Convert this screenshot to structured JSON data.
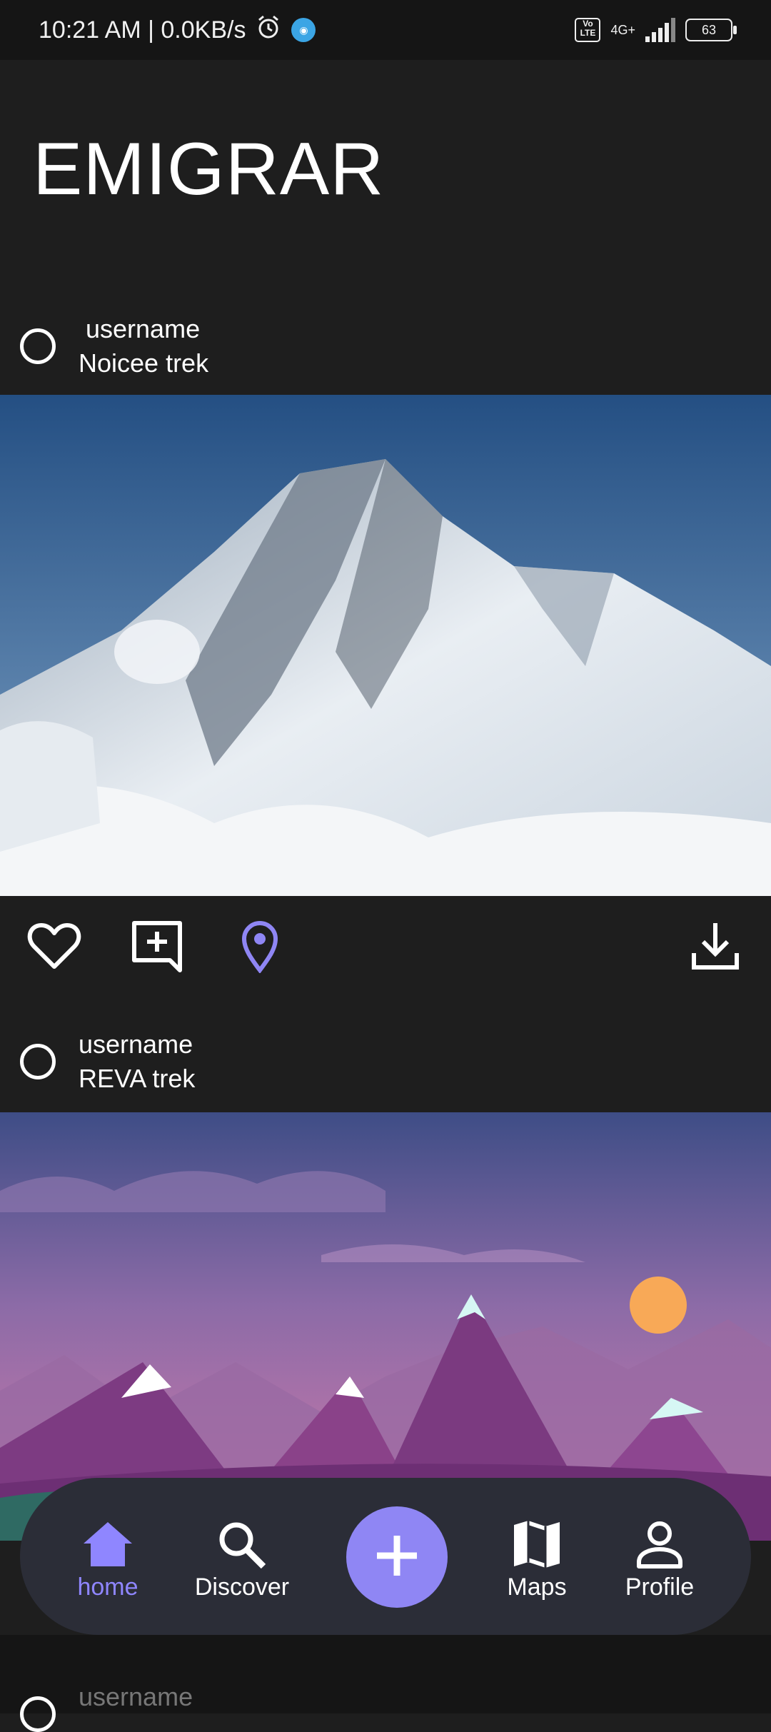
{
  "status_bar": {
    "time": "10:21 AM | 0.0KB/s",
    "volte": "Vo LTE",
    "network": "4G+",
    "battery": "63"
  },
  "app": {
    "title": "EMIGRAR"
  },
  "posts": [
    {
      "username": "username",
      "trek": "Noicee trek"
    },
    {
      "username": "username",
      "trek": "REVA trek"
    },
    {
      "username": "username"
    }
  ],
  "nav": {
    "home": "home",
    "discover": "Discover",
    "maps": "Maps",
    "profile": "Profile"
  },
  "colors": {
    "accent": "#8f86f4",
    "background": "#1e1e1e",
    "nav": "#2b2d37"
  },
  "icons": [
    "alarm-icon",
    "app-badge-icon",
    "heart-icon",
    "add-comment-icon",
    "location-pin-icon",
    "download-icon",
    "home-icon",
    "search-icon",
    "plus-icon",
    "map-icon",
    "person-icon"
  ]
}
